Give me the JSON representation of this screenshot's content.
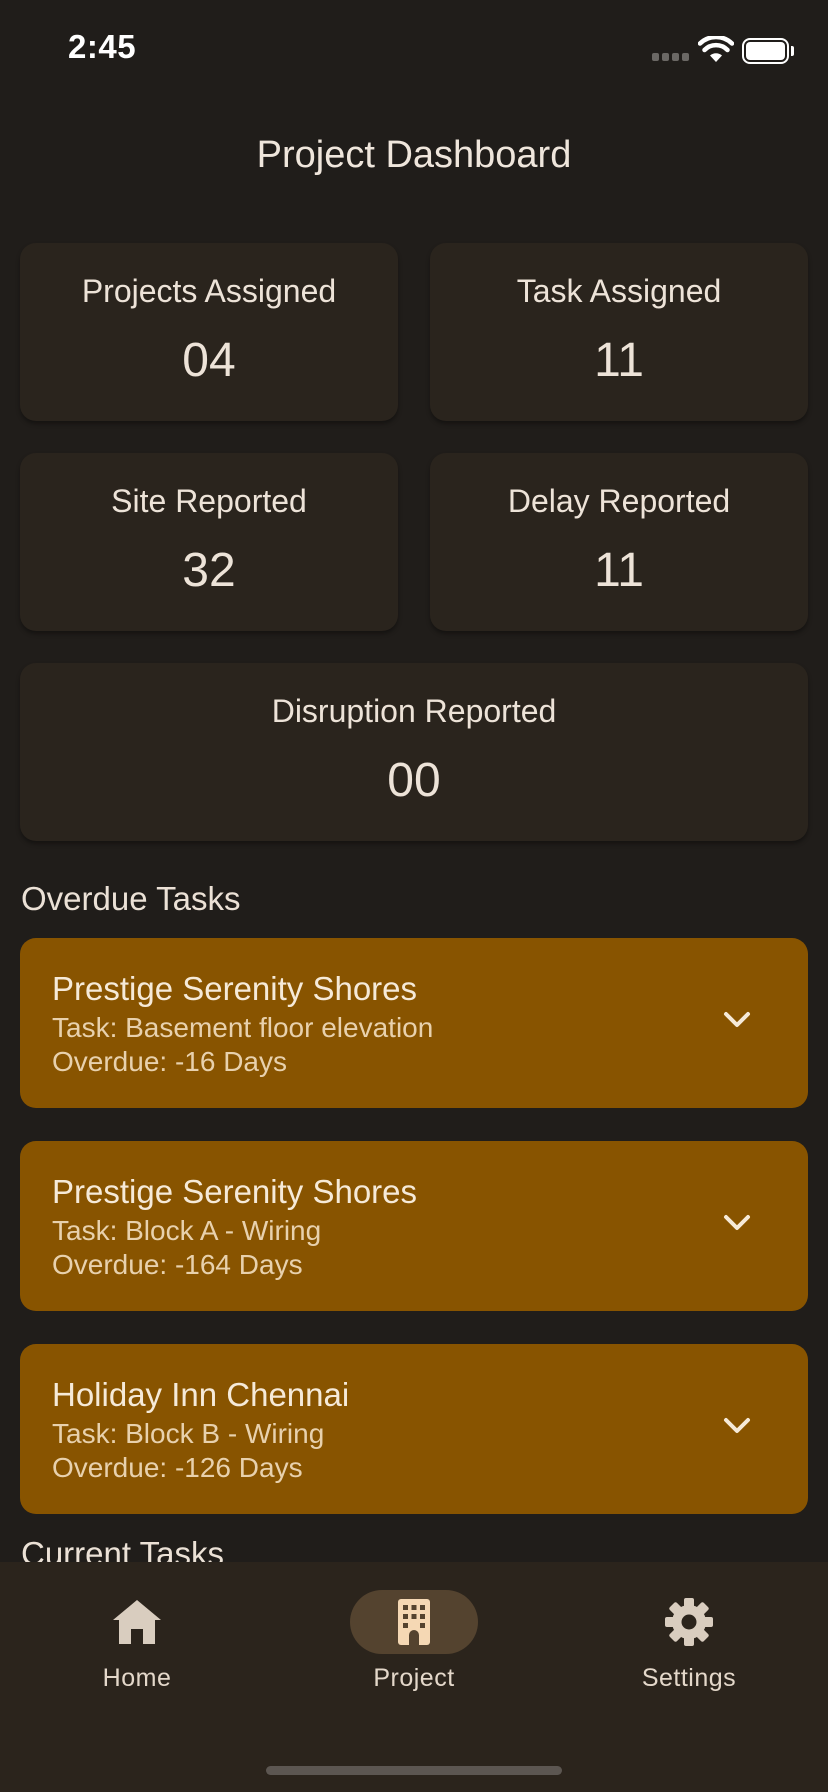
{
  "status_bar": {
    "time": "2:45"
  },
  "header": {
    "title": "Project Dashboard"
  },
  "stats": [
    {
      "label": "Projects Assigned",
      "value": "04"
    },
    {
      "label": "Task Assigned",
      "value": "11"
    },
    {
      "label": "Site Reported",
      "value": "32"
    },
    {
      "label": "Delay Reported",
      "value": "11"
    },
    {
      "label": "Disruption Reported",
      "value": "00"
    }
  ],
  "overdue_section": {
    "title": "Overdue Tasks",
    "tasks": [
      {
        "project": "Prestige Serenity Shores",
        "task": "Task: Basement floor elevation",
        "overdue": "Overdue: -16 Days"
      },
      {
        "project": "Prestige Serenity Shores",
        "task": "Task: Block A - Wiring",
        "overdue": "Overdue: -164 Days"
      },
      {
        "project": "Holiday Inn Chennai",
        "task": "Task: Block B - Wiring",
        "overdue": "Overdue: -126 Days"
      }
    ]
  },
  "current_section": {
    "title": "Current Tasks"
  },
  "bottom_nav": {
    "items": [
      {
        "label": "Home",
        "icon": "home-icon",
        "selected": false
      },
      {
        "label": "Project",
        "icon": "building-icon",
        "selected": true
      },
      {
        "label": "Settings",
        "icon": "gear-icon",
        "selected": false
      }
    ]
  },
  "colors": {
    "background": "#201d1a",
    "card": "#2a241d",
    "overdue_card": "#885400",
    "nav_background": "#2b241c",
    "nav_selected_pill": "#54432f"
  }
}
